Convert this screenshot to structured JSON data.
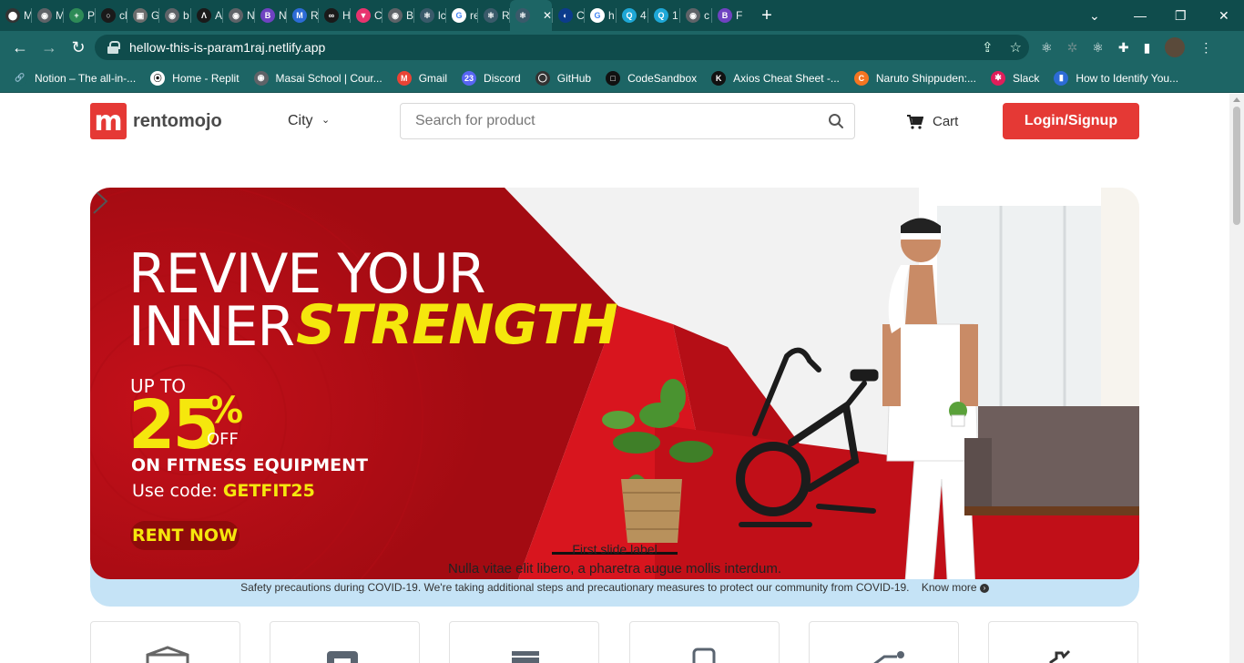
{
  "browser": {
    "tabs": [
      {
        "label": "M",
        "color": "#333333",
        "glyph": "⬤"
      },
      {
        "label": "M",
        "color": "#5f6368",
        "glyph": "◉"
      },
      {
        "label": "P",
        "color": "#2e8b57",
        "glyph": "+"
      },
      {
        "label": "cl",
        "color": "#1a1a1a",
        "glyph": "○"
      },
      {
        "label": "G",
        "color": "#6d6d6d",
        "glyph": "▣"
      },
      {
        "label": "b",
        "color": "#5f6368",
        "glyph": "◉"
      },
      {
        "label": "A",
        "color": "#1a1a1a",
        "glyph": "Λ"
      },
      {
        "label": "N",
        "color": "#5f6368",
        "glyph": "◉"
      },
      {
        "label": "N",
        "color": "#6f42c1",
        "glyph": "B"
      },
      {
        "label": "R",
        "color": "#2c6bd6",
        "glyph": "M"
      },
      {
        "label": "H",
        "color": "#1a1a1a",
        "glyph": "∞"
      },
      {
        "label": "C",
        "color": "#e8336e",
        "glyph": "▼"
      },
      {
        "label": "B",
        "color": "#5f6368",
        "glyph": "◉"
      },
      {
        "label": "lc",
        "color": "#3a5a6a",
        "glyph": "⚛"
      },
      {
        "label": "re",
        "color": "#ffffff",
        "glyph": "G"
      },
      {
        "label": "R",
        "color": "#3a5a6a",
        "glyph": "⚛"
      },
      {
        "label": "",
        "color": "#3a5a6a",
        "glyph": "⚛"
      },
      {
        "label": "C",
        "color": "#0c3b8c",
        "glyph": "◐"
      },
      {
        "label": "h",
        "color": "#ffffff",
        "glyph": "G"
      },
      {
        "label": "4",
        "color": "#1ea7d6",
        "glyph": "Q"
      },
      {
        "label": "1",
        "color": "#1ea7d6",
        "glyph": "Q"
      },
      {
        "label": "c",
        "color": "#5f6368",
        "glyph": "◉"
      },
      {
        "label": "F",
        "color": "#6f42c1",
        "glyph": "B"
      }
    ],
    "active_tab_index": 16,
    "new_tab": "+",
    "url": "hellow-this-is-param1raj.netlify.app",
    "bookmarks": [
      {
        "label": "Notion – The all-in-...",
        "color": "#1d6565",
        "glyph": "🔗"
      },
      {
        "label": "Home - Replit",
        "color": "#ffffff",
        "glyph": "⦿"
      },
      {
        "label": "Masai School | Cour...",
        "color": "#5f6368",
        "glyph": "◉"
      },
      {
        "label": "Gmail",
        "color": "#ea4335",
        "glyph": "M"
      },
      {
        "label": "Discord",
        "color": "#5865f2",
        "glyph": "23"
      },
      {
        "label": "GitHub",
        "color": "#333333",
        "glyph": "◯"
      },
      {
        "label": "CodeSandbox",
        "color": "#111111",
        "glyph": "□"
      },
      {
        "label": "Axios Cheat Sheet -...",
        "color": "#111111",
        "glyph": "K"
      },
      {
        "label": "Naruto Shippuden:...",
        "color": "#f47521",
        "glyph": "C"
      },
      {
        "label": "Slack",
        "color": "#e01e5a",
        "glyph": "✱"
      },
      {
        "label": "How to Identify You...",
        "color": "#2c6bd6",
        "glyph": "▮"
      }
    ]
  },
  "site": {
    "logo_letter": "m",
    "brand": "rentomojo",
    "city_label": "City",
    "search_placeholder": "Search for product",
    "cart_label": "Cart",
    "login_label": "Login/Signup",
    "accent_color": "#e53935"
  },
  "banner": {
    "headline_line1": "REVIVE YOUR",
    "headline_line2_white": "INNER",
    "headline_line2_yellow": "STRENGTH",
    "up_to": "UP TO",
    "discount_number": "25",
    "discount_symbol": "%",
    "off": "OFF",
    "subject": "ON FITNESS EQUIPMENT",
    "code_prefix": "Use code:",
    "code": "GETFIT25",
    "cta": "RENT NOW",
    "caption_title": "First slide label",
    "caption_text": "Nulla vitae elit libero, a pharetra augue mollis interdum."
  },
  "covid": {
    "text": "Safety precautions during COVID-19. We're taking additional steps and precautionary measures to protect our community from COVID-19.",
    "link": "Know more"
  },
  "categories": [
    {
      "icon": "package-icon"
    },
    {
      "icon": "sofa-icon"
    },
    {
      "icon": "appliance-icon"
    },
    {
      "icon": "phone-icon"
    },
    {
      "icon": "fitness-icon"
    },
    {
      "icon": "hand-icon"
    }
  ]
}
